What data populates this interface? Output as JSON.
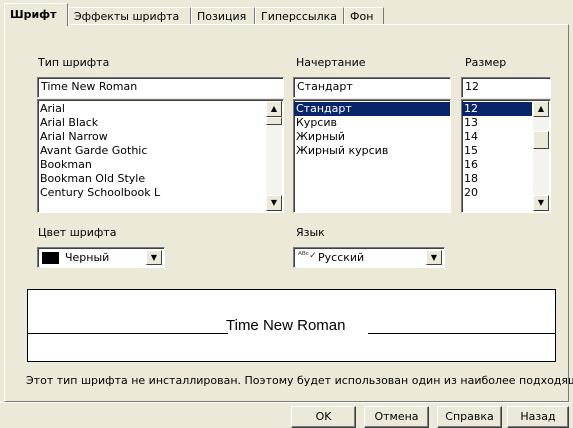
{
  "tabs": [
    {
      "label": "Шрифт",
      "active": true
    },
    {
      "label": "Эффекты шрифта",
      "active": false
    },
    {
      "label": "Позиция",
      "active": false
    },
    {
      "label": "Гиперссылка",
      "active": false
    },
    {
      "label": "Фон",
      "active": false
    }
  ],
  "font": {
    "label": "Тип шрифта",
    "value": "Time New Roman",
    "items": [
      "Arial",
      "Arial Black",
      "Arial Narrow",
      "Avant Garde Gothic",
      "Bookman",
      "Bookman Old Style",
      "Century Schoolbook L"
    ]
  },
  "style": {
    "label": "Начертание",
    "value": "Стандарт",
    "items": [
      "Стандарт",
      "Курсив",
      "Жирный",
      "Жирный курсив"
    ],
    "selected": "Стандарт"
  },
  "size": {
    "label": "Размер",
    "value": "12",
    "items": [
      "12",
      "13",
      "14",
      "15",
      "16",
      "18",
      "20"
    ],
    "selected": "12"
  },
  "color": {
    "label": "Цвет шрифта",
    "value": "Черный",
    "swatch": "#000000"
  },
  "language": {
    "label": "Язык",
    "value": "Русский"
  },
  "preview": {
    "text": "Time New Roman"
  },
  "status": "Этот тип шрифта не инсталлирован. Поэтому будет использован один из наиболее подходящ",
  "buttons": {
    "ok": "OK",
    "cancel": "Отмена",
    "help": "Справка",
    "back": "Назад"
  }
}
